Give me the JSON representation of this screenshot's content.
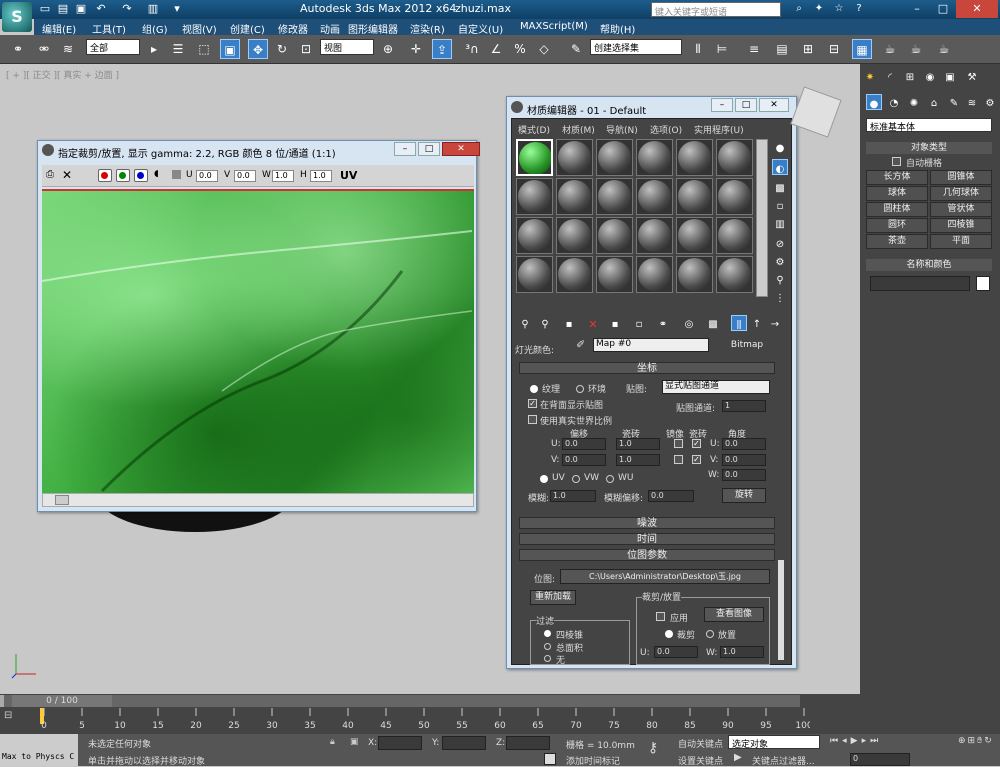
{
  "titlebar": {
    "app_title": "Autodesk 3ds Max  2012 x64",
    "filename": "zhuzi.max",
    "search_placeholder": "键入关键字或短语"
  },
  "menubar": {
    "items": [
      "编辑(E)",
      "工具(T)",
      "组(G)",
      "视图(V)",
      "创建(C)",
      "修改器",
      "动画",
      "图形编辑器",
      "渲染(R)",
      "自定义(U)",
      "MAXScript(M)",
      "帮助(H)"
    ]
  },
  "toolbar": {
    "selection_filter": "全部",
    "ref_coord": "视图",
    "named_selection": "创建选择集"
  },
  "viewport": {
    "label": "[ + ][ 正交 ][ 真实 + 边面 ]"
  },
  "frame_window": {
    "title": "指定裁剪/放置, 显示 gamma: 2.2, RGB 颜色 8 位/通道 (1:1)",
    "u_label": "U",
    "u_value": "0.0",
    "v_label": "V",
    "v_value": "0.0",
    "w_label": "W",
    "w_value": "1.0",
    "h_label": "H",
    "h_value": "1.0",
    "uv_label": "UV"
  },
  "material_editor": {
    "title": "材质编辑器 - 01 - Default",
    "menu": [
      "模式(D)",
      "材质(M)",
      "导航(N)",
      "选项(O)",
      "实用程序(U)"
    ],
    "light_color_label": "灯光颜色:",
    "map_name": "Map #0",
    "map_type": "Bitmap",
    "coords": {
      "header": "坐标",
      "texture": "纹理",
      "environ": "环境",
      "mapping_label": "贴图:",
      "mapping_value": "显式贴图通道",
      "show_map_back": "在背面显示贴图",
      "map_channel_label": "贴图通道:",
      "map_channel_value": "1",
      "real_world": "使用真实世界比例",
      "offset": "偏移",
      "tiling": "瓷砖",
      "mirror": "镜像",
      "tile": "瓷砖",
      "angle": "角度",
      "u": "U:",
      "v": "V:",
      "w": "W:",
      "u_offset": "0.0",
      "v_offset": "0.0",
      "u_tiling": "1.0",
      "v_tiling": "1.0",
      "u_angle": "0.0",
      "v_angle": "0.0",
      "w_angle": "0.0",
      "uv": "UV",
      "vw": "VW",
      "wu": "WU",
      "blur_label": "模糊:",
      "blur_value": "1.0",
      "blur_offset_label": "模糊偏移:",
      "blur_offset_value": "0.0",
      "rotate_button": "旋转"
    },
    "noise_header": "噪波",
    "time_header": "时间",
    "bitmap_params": {
      "header": "位图参数",
      "bitmap_label": "位图:",
      "bitmap_path": "C:\\Users\\Administrator\\Desktop\\玉.jpg",
      "reload_button": "重新加载",
      "crop_group": "裁剪/放置",
      "apply_label": "应用",
      "view_image_button": "查看图像",
      "crop": "裁剪",
      "place": "放置",
      "u_label": "U:",
      "u_value": "0.0",
      "w_label": "W:",
      "w_value": "1.0",
      "filter_group": "过滤",
      "filter_pyramidal": "四棱锥",
      "filter_sat": "总面积",
      "filter_none": "无"
    }
  },
  "command_panel": {
    "dropdown": "标准基本体",
    "object_type_header": "对象类型",
    "autogrid": "自动栅格",
    "buttons": [
      "长方体",
      "圆锥体",
      "球体",
      "几何球体",
      "圆柱体",
      "管状体",
      "圆环",
      "四棱锥",
      "茶壶",
      "平面"
    ],
    "name_color_header": "名称和颜色"
  },
  "timeline": {
    "frame_counter": "0 / 100",
    "ticks": [
      "0",
      "5",
      "10",
      "15",
      "20",
      "25",
      "30",
      "35",
      "40",
      "45",
      "50",
      "55",
      "60",
      "65",
      "70",
      "75",
      "80",
      "85",
      "90",
      "95",
      "100"
    ]
  },
  "statusbar": {
    "script_label": "Max to Physcs C",
    "status_line1": "未选定任何对象",
    "status_line2": "单击并拖动以选择并移动对象",
    "x_label": "X:",
    "y_label": "Y:",
    "z_label": "Z:",
    "grid_label": "栅格 = 10.0mm",
    "add_time_tag": "添加时间标记",
    "auto_key": "自动关键点",
    "set_key": "设置关键点",
    "key_mode": "选定对象",
    "key_filters": "关键点过滤器...",
    "frame_value": "0"
  },
  "colors": {
    "title_blue": "#1d5d8c",
    "toolbar_gray": "#5a5a5a",
    "viewport_gray": "#c8c8c8",
    "texture_green": "#3fae3f"
  }
}
